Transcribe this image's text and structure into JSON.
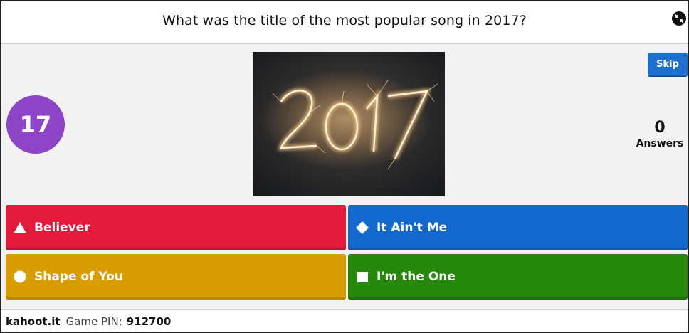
{
  "question": {
    "text": "What was the title of the most popular song in 2017?"
  },
  "icons": {
    "fullscreen": "exit-fullscreen-icon",
    "triangle": "triangle-icon",
    "diamond": "diamond-icon",
    "circle": "circle-icon",
    "square": "square-icon"
  },
  "timer": {
    "value": "17",
    "color": "#8e44c7"
  },
  "media": {
    "caption": "2017"
  },
  "controls": {
    "skip_label": "Skip"
  },
  "answers_count": {
    "value": "0",
    "label": "Answers"
  },
  "answers": [
    {
      "label": "Believer",
      "shape": "triangle",
      "color": "#e21b3c"
    },
    {
      "label": "It Ain't Me",
      "shape": "diamond",
      "color": "#1368ce"
    },
    {
      "label": "Shape of You",
      "shape": "circle",
      "color": "#d89e00"
    },
    {
      "label": "I'm the One",
      "shape": "square",
      "color": "#26890c"
    }
  ],
  "footer": {
    "brand": "kahoot.it",
    "pin_label": "Game PIN:",
    "pin_value": "912700"
  }
}
